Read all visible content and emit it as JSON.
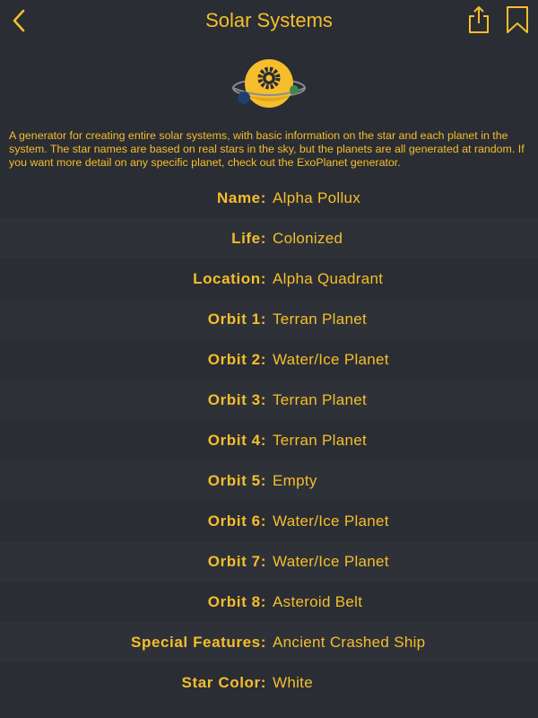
{
  "colors": {
    "accent": "#f6be2c",
    "background": "#2a2d33",
    "row_alt": "#2e3137"
  },
  "header": {
    "title": "Solar Systems",
    "back_icon": "chevron-left-icon",
    "share_icon": "share-icon",
    "bookmark_icon": "bookmark-icon"
  },
  "logo_icon": "solar-system-icon",
  "description": "A generator for creating entire solar systems, with basic information on the star and each planet in the system. The star names are based on real stars in the sky, but the planets are all generated at random. If you want more detail on any specific planet, check out the ExoPlanet generator.",
  "rows": [
    {
      "label": "Name:",
      "value": "Alpha Pollux"
    },
    {
      "label": "Life:",
      "value": "Colonized"
    },
    {
      "label": "Location:",
      "value": "Alpha Quadrant"
    },
    {
      "label": "Orbit 1:",
      "value": "Terran Planet"
    },
    {
      "label": "Orbit 2:",
      "value": "Water/Ice Planet"
    },
    {
      "label": "Orbit 3:",
      "value": "Terran Planet"
    },
    {
      "label": "Orbit 4:",
      "value": "Terran Planet"
    },
    {
      "label": "Orbit 5:",
      "value": "Empty"
    },
    {
      "label": "Orbit 6:",
      "value": "Water/Ice Planet"
    },
    {
      "label": "Orbit 7:",
      "value": "Water/Ice Planet"
    },
    {
      "label": "Orbit 8:",
      "value": "Asteroid Belt"
    },
    {
      "label": "Special Features:",
      "value": "Ancient Crashed Ship"
    },
    {
      "label": "Star Color:",
      "value": "White"
    }
  ]
}
